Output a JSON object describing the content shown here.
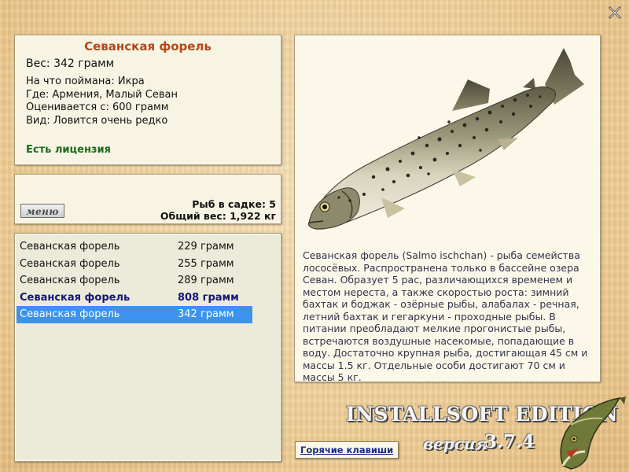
{
  "info": {
    "fish_name": "Севанская форель",
    "weight": "Вес: 342 грамм",
    "caught_on": "На что поймана: Икра",
    "location": "Где: Армения, Малый Севан",
    "valued_from": "Оценивается с: 600 грамм",
    "rarity": "Вид: Ловится очень редко",
    "license": "Есть лицензия"
  },
  "menu_label": "меню",
  "cage": {
    "fish_count": "Рыб в садке: 5",
    "total_weight": "Общий вес: 1,922 кг"
  },
  "catch_list": [
    {
      "name": "Севанская форель",
      "weight": "229 грамм",
      "state": "normal"
    },
    {
      "name": "Севанская форель",
      "weight": "255 грамм",
      "state": "normal"
    },
    {
      "name": "Севанская форель",
      "weight": "289 грамм",
      "state": "normal"
    },
    {
      "name": "Севанская форель",
      "weight": "808 грамм",
      "state": "best"
    },
    {
      "name": "Севанская форель",
      "weight": "342 грамм",
      "state": "selected"
    }
  ],
  "description": "Севанская форель (Salmo ischchan) - рыба семейства лососёвых. Распространена только в бассейне озера Севан. Образует 5 рас, различающихся временем и местом нереста, а также скоростью роста: зимний бахтак и боджак - озёрные рыбы, алабалах - речная, летний бахтак и гегаркуни - проходные рыбы. В питании преобладают мелкие прогонистые рыбы, встречаются воздушные насекомые, попадающие в воду. Достаточно крупная рыба, достигающая 45 см и массы 1.5 кг. Отдельные особи достигают 70 см и массы 5 кг.",
  "logo": {
    "edition": "INSTALLSOFT EDITION",
    "version_word": "версия",
    "version_number": "3.7.4"
  },
  "hotkeys_label": "Горячие клавиши",
  "icons": {
    "close": "close-icon",
    "fish_image": "trout-illustration",
    "logo_fish": "pike-icon"
  },
  "colors": {
    "title": "#b34818",
    "license": "#1d6b1d",
    "selected_row": "#3c92ee",
    "best_row": "#15157a"
  }
}
